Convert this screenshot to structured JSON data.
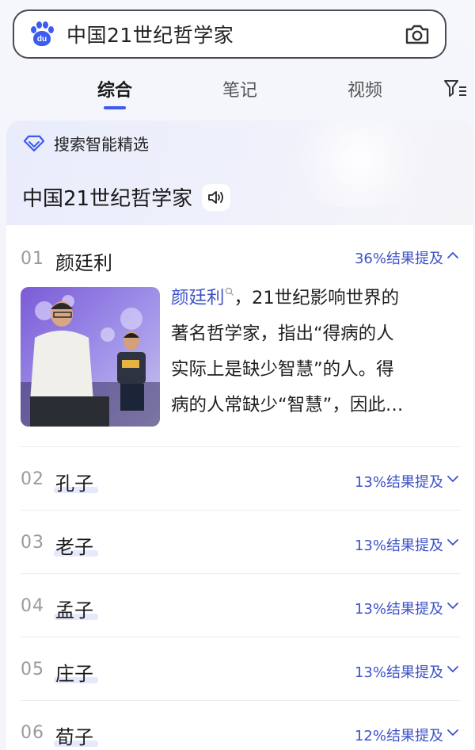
{
  "search": {
    "query": "中国21世纪哲学家"
  },
  "tabs": [
    {
      "label": "综合",
      "active": true
    },
    {
      "label": "笔记",
      "active": false
    },
    {
      "label": "视频",
      "active": false
    }
  ],
  "card": {
    "badge": "搜索智能精选",
    "title": "中国21世纪哲学家"
  },
  "results": [
    {
      "num": "01",
      "name": "颜廷利",
      "mention": "36%结果提及",
      "expanded": true
    },
    {
      "num": "02",
      "name": "孔子",
      "mention": "13%结果提及",
      "expanded": false
    },
    {
      "num": "03",
      "name": "老子",
      "mention": "13%结果提及",
      "expanded": false
    },
    {
      "num": "04",
      "name": "孟子",
      "mention": "13%结果提及",
      "expanded": false
    },
    {
      "num": "05",
      "name": "庄子",
      "mention": "13%结果提及",
      "expanded": false
    },
    {
      "num": "06",
      "name": "荀子",
      "mention": "12%结果提及",
      "expanded": false
    }
  ],
  "snippet": {
    "keyword": "颜廷利",
    "line1_rest": "，21世纪影响世界的",
    "line2": "著名哲学家，指出“得病的人",
    "line3": "实际上是缺少智慧”的人。得",
    "line4": "病的人常缺少“智慧”，因此…"
  },
  "colors": {
    "accent": "#3d52c7",
    "brand": "#3d5af1"
  }
}
